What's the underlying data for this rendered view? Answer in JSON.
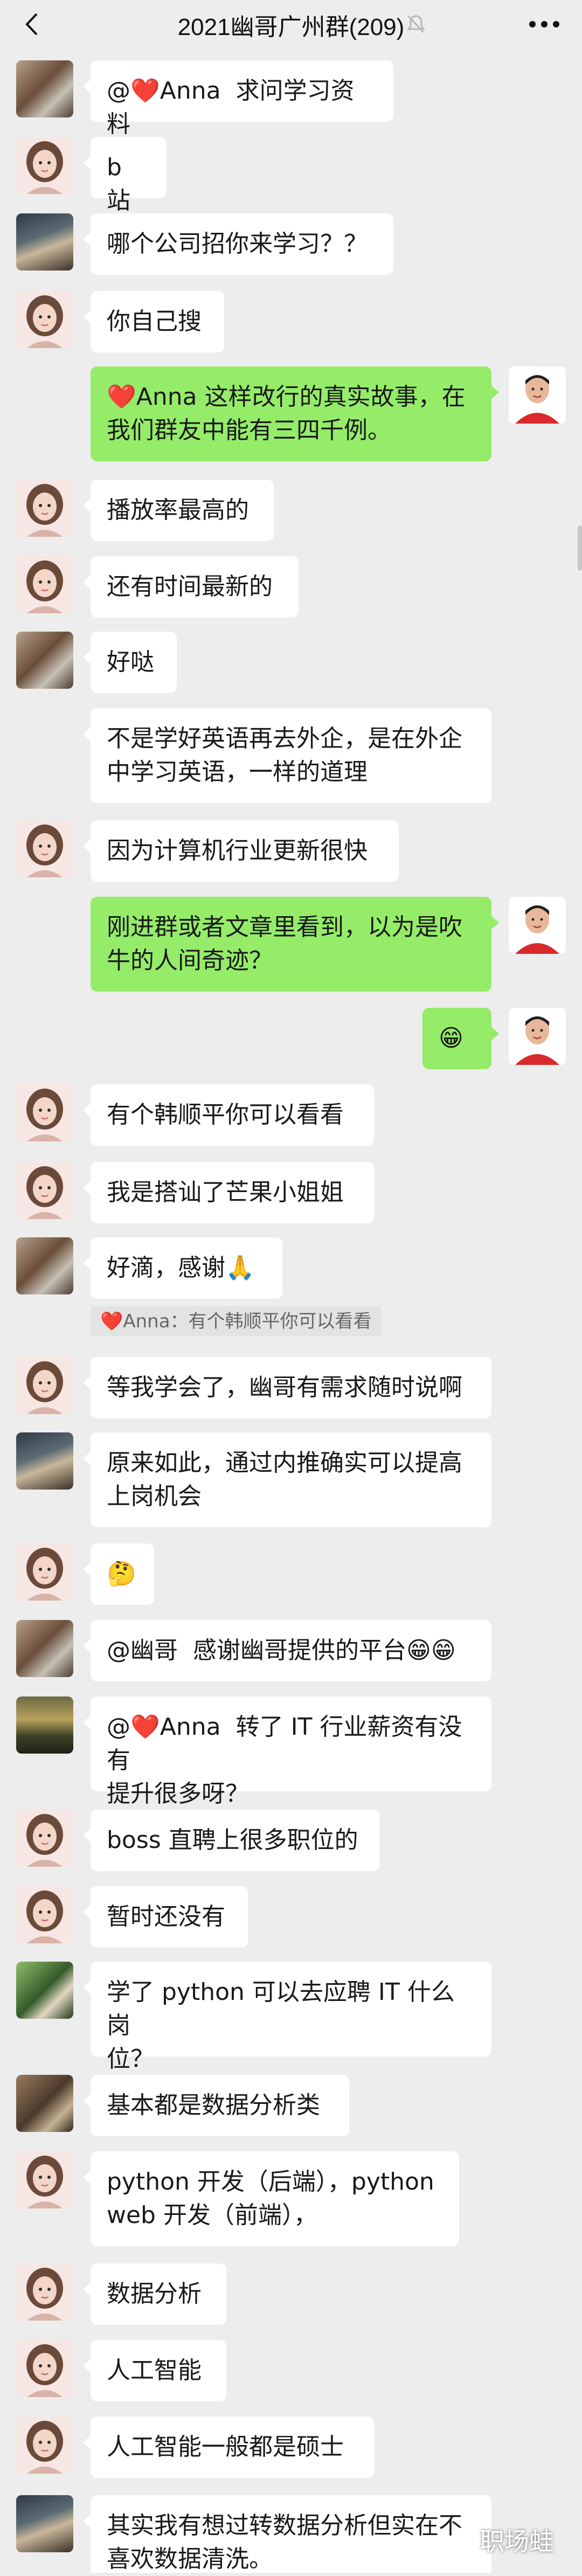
{
  "header": {
    "title": "2021幽哥广州群(209)"
  },
  "messages": [
    {
      "side": "left",
      "avatar": "avatar-photo",
      "text": "@❤️Anna  求问学习资料"
    },
    {
      "side": "left",
      "avatar": "avatar-anna",
      "text": "b 站"
    },
    {
      "side": "left",
      "avatar": "avatar-photo",
      "text": "哪个公司招你来学习？？"
    },
    {
      "side": "left",
      "avatar": "avatar-anna",
      "text": "你自己搜"
    },
    {
      "side": "right",
      "avatar": "avatar-you",
      "text": "❤️Anna 这样改行的真实故事，在\n我们群友中能有三四千例。"
    },
    {
      "side": "left",
      "avatar": "avatar-anna",
      "text": "播放率最高的"
    },
    {
      "side": "left",
      "avatar": "avatar-anna",
      "text": "还有时间最新的"
    },
    {
      "side": "left",
      "avatar": "avatar-photo",
      "text": "好哒"
    },
    {
      "side": "left",
      "avatar": "",
      "text": "不是学好英语再去外企，是在外企\n中学习英语，一样的道理"
    },
    {
      "side": "left",
      "avatar": "avatar-anna",
      "text": "因为计算机行业更新很快"
    },
    {
      "side": "right",
      "avatar": "avatar-you",
      "text": "刚进群或者文章里看到，以为是吹\n牛的人间奇迹？"
    },
    {
      "side": "right",
      "avatar": "avatar-you",
      "text": "😁"
    },
    {
      "side": "left",
      "avatar": "avatar-anna",
      "text": "有个韩顺平你可以看看"
    },
    {
      "side": "left",
      "avatar": "avatar-anna",
      "text": "我是搭讪了芒果小姐姐"
    },
    {
      "side": "left",
      "avatar": "avatar-photo",
      "text": "好滴，感谢🙏"
    },
    {
      "side": "left",
      "avatar": "avatar-anna",
      "text": "等我学会了，幽哥有需求随时说啊"
    },
    {
      "side": "left",
      "avatar": "avatar-photo",
      "text": "原来如此，通过内推确实可以提高\n上岗机会"
    },
    {
      "side": "left",
      "avatar": "avatar-anna",
      "text": "🤔"
    },
    {
      "side": "left",
      "avatar": "avatar-photo",
      "text": "@幽哥  感谢幽哥提供的平台😁😁"
    },
    {
      "side": "left",
      "avatar": "avatar-photo",
      "text": "@❤️Anna  转了 IT 行业薪资有没有\n提升很多呀？"
    },
    {
      "side": "left",
      "avatar": "avatar-anna",
      "text": "boss 直聘上很多职位的"
    },
    {
      "side": "left",
      "avatar": "avatar-anna",
      "text": "暂时还没有"
    },
    {
      "side": "left",
      "avatar": "avatar-photo",
      "text": "学了 python 可以去应聘 IT 什么岗\n位？"
    },
    {
      "side": "left",
      "avatar": "avatar-photo",
      "text": "基本都是数据分析类"
    },
    {
      "side": "left",
      "avatar": "avatar-anna",
      "text": "python 开发（后端），python\nweb 开发（前端），"
    },
    {
      "side": "left",
      "avatar": "avatar-anna",
      "text": "数据分析"
    },
    {
      "side": "left",
      "avatar": "avatar-anna",
      "text": "人工智能"
    },
    {
      "side": "left",
      "avatar": "avatar-anna",
      "text": "人工智能一般都是硕士"
    },
    {
      "side": "left",
      "avatar": "avatar-photo",
      "text": "其实我有想过转数据分析但实在不\n喜欢数据清洗。"
    }
  ],
  "quote": {
    "text": "❤️Anna：有个韩顺平你可以看看"
  },
  "watermark": {
    "text": "职场蛙"
  }
}
